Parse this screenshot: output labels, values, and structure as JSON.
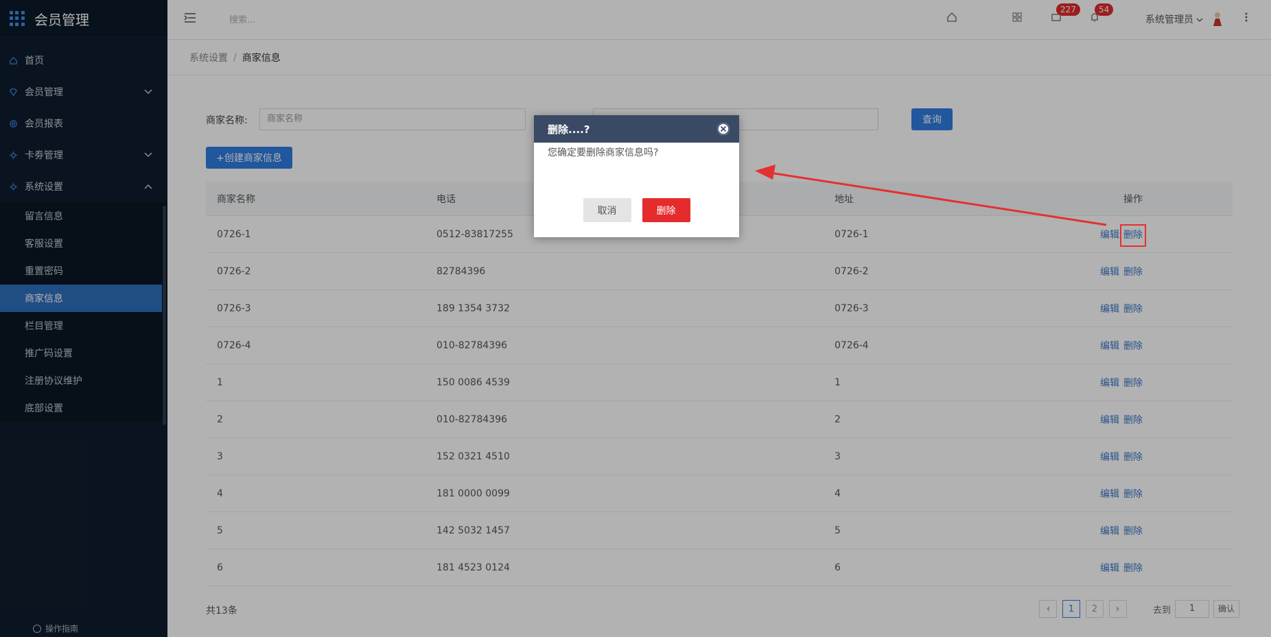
{
  "sidebar": {
    "app_title": "会员管理",
    "items": [
      {
        "label": "首页"
      },
      {
        "label": "会员管理"
      },
      {
        "label": "会员报表"
      },
      {
        "label": "卡劵管理"
      },
      {
        "label": "系统设置"
      }
    ],
    "sub_items": [
      {
        "label": "留言信息"
      },
      {
        "label": "客服设置"
      },
      {
        "label": "重置密码"
      },
      {
        "label": "商家信息"
      },
      {
        "label": "栏目管理"
      },
      {
        "label": "推广码设置"
      },
      {
        "label": "注册协议维护"
      },
      {
        "label": "底部设置"
      }
    ],
    "guide_label": "操作指南"
  },
  "header": {
    "search_placeholder": "搜索...",
    "mail_count": "227",
    "notify_count": "54",
    "user_name": "系统管理员"
  },
  "breadcrumb": {
    "parent": "系统设置",
    "separator": "/",
    "current": "商家信息"
  },
  "filter": {
    "label": "商家名称:",
    "placeholder": "商家名称",
    "query_label": "查询",
    "create_label": "+创建商家信息"
  },
  "table": {
    "headers": [
      "商家名称",
      "电话",
      "地址",
      "操作"
    ],
    "rows": [
      {
        "name": "0726-1",
        "phone": "0512-83817255",
        "address": "0726-1"
      },
      {
        "name": "0726-2",
        "phone": "82784396",
        "address": "0726-2"
      },
      {
        "name": "0726-3",
        "phone": "189 1354 3732",
        "address": "0726-3"
      },
      {
        "name": "0726-4",
        "phone": "010-82784396",
        "address": "0726-4"
      },
      {
        "name": "1",
        "phone": "150 0086 4539",
        "address": "1"
      },
      {
        "name": "2",
        "phone": "010-82784396",
        "address": "2"
      },
      {
        "name": "3",
        "phone": "152 0321 4510",
        "address": "3"
      },
      {
        "name": "4",
        "phone": "181 0000 0099",
        "address": "4"
      },
      {
        "name": "5",
        "phone": "142 5032 1457",
        "address": "5"
      },
      {
        "name": "6",
        "phone": "181 4523 0124",
        "address": "6"
      }
    ],
    "edit_label": "编辑",
    "delete_label": "删除"
  },
  "pagination": {
    "total": "共13条",
    "page1": "1",
    "page2": "2",
    "goto_label": "去到",
    "goto_value": "1",
    "confirm_label": "确认"
  },
  "modal": {
    "title": "删除....?",
    "message": "您确定要删除商家信息吗?",
    "cancel_label": "取消",
    "delete_label": "删除"
  },
  "colors": {
    "sidebar_bg": "#0f1e2e",
    "accent": "#2f7de1",
    "danger": "#e52b2b",
    "annotation": "#e53030"
  }
}
